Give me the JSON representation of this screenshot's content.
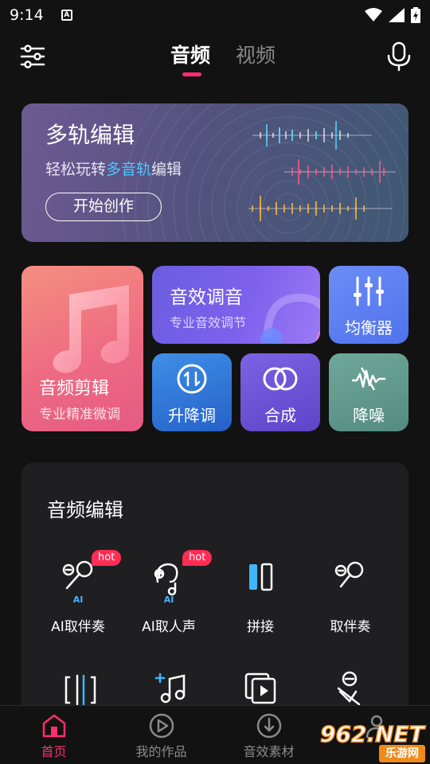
{
  "status_bar": {
    "time": "9:14",
    "notification_glyph": "A"
  },
  "header": {
    "tabs": [
      {
        "label": "音频",
        "active": true
      },
      {
        "label": "视频",
        "active": false
      }
    ],
    "accent_color": "#ff2d6f"
  },
  "banner": {
    "title": "多轨编辑",
    "subtitle_pre": "轻松玩转",
    "subtitle_highlight": "多音轨",
    "subtitle_post": "编辑",
    "button_label": "开始创作"
  },
  "features": {
    "audio_cut": {
      "title": "音频剪辑",
      "subtitle": "专业精准微调"
    },
    "sound_fx": {
      "title": "音效调音",
      "subtitle": "专业音效调节"
    },
    "equalizer": {
      "label": "均衡器"
    },
    "pitch": {
      "label": "升降调"
    },
    "mix": {
      "label": "合成"
    },
    "denoise": {
      "label": "降噪"
    }
  },
  "audio_edit": {
    "title": "音频编辑",
    "tools": [
      {
        "label": "AI取伴奏",
        "badge": "hot",
        "ai_tag": "AI",
        "icon": "mic-ai-icon"
      },
      {
        "label": "AI取人声",
        "badge": "hot",
        "ai_tag": "AI",
        "icon": "voice-ai-icon"
      },
      {
        "label": "拼接",
        "icon": "splice-icon"
      },
      {
        "label": "取伴奏",
        "icon": "mic-icon"
      }
    ]
  },
  "bottom_nav": [
    {
      "label": "首页",
      "icon": "home-icon",
      "active": true
    },
    {
      "label": "我的作品",
      "icon": "play-circle-icon",
      "active": false
    },
    {
      "label": "音效素材",
      "icon": "music-download-icon",
      "active": false
    }
  ],
  "watermark": {
    "number": "962.NET",
    "text": "乐游网"
  }
}
